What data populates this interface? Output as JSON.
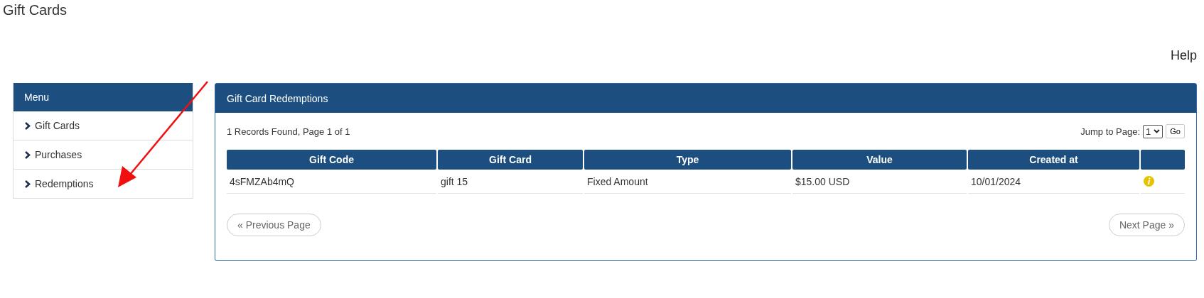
{
  "page_title": "Gift Cards",
  "help_link": "Help",
  "menu": {
    "title": "Menu",
    "items": [
      {
        "label": "Gift Cards"
      },
      {
        "label": "Purchases"
      },
      {
        "label": "Redemptions"
      }
    ]
  },
  "panel": {
    "title": "Gift Card Redemptions",
    "records_info": "1 Records Found, Page 1 of 1",
    "jump_label": "Jump to Page:",
    "page_select": "1",
    "go_button": "Go",
    "table": {
      "columns": [
        "Gift Code",
        "Gift Card",
        "Type",
        "Value",
        "Created at",
        ""
      ],
      "rows": [
        {
          "cells": [
            "4sFMZAb4mQ",
            "gift 15",
            "Fixed Amount",
            "$15.00 USD",
            "10/01/2024"
          ],
          "info_icon": true
        }
      ]
    },
    "previous_button": "« Previous Page",
    "next_button": "Next Page »"
  }
}
